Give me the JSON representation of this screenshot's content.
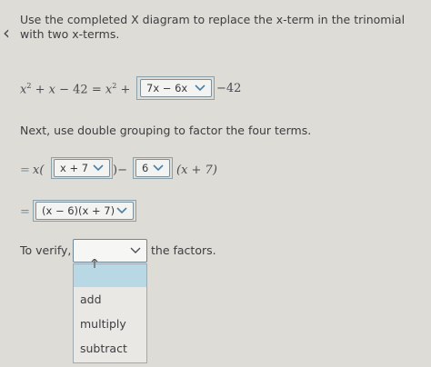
{
  "instructions": "Use the completed X diagram to replace the x-term in the trinomial with two x-terms.",
  "line1": {
    "lhs_term": "x",
    "lhs_exp": "2",
    "lhs_plus": "+",
    "lhs_x": "x",
    "lhs_minus": "−",
    "lhs_const": "42",
    "equals": "=",
    "rhs_term": "x",
    "rhs_exp": "2",
    "rhs_plus": "+",
    "dropdown_value": "7x − 6x",
    "tail": "−42"
  },
  "next_text": "Next, use double grouping to factor the four terms.",
  "line2": {
    "equals": "=",
    "prefix": "x(",
    "dropdown1_value": "x + 7",
    "close_minus": ")−",
    "dropdown2_value": "6",
    "suffix": "(x + 7)"
  },
  "line3": {
    "equals": "=",
    "dropdown_value": "(x − 6)(x + 7)"
  },
  "verify": {
    "prefix": "To verify,",
    "dropdown_value": "",
    "suffix": "the factors."
  },
  "menu_options": [
    "add",
    "multiply",
    "subtract"
  ],
  "icons": {
    "back": "chevron-left-icon",
    "dropdown": "chevron-down-icon",
    "cursor": "mouse-pointer-icon"
  },
  "colors": {
    "background": "#dedcd7",
    "border": "#7f8f99",
    "highlight": "#b9d8e6"
  }
}
